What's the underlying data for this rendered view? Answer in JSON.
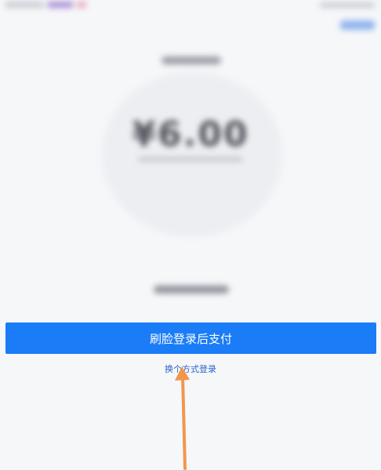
{
  "main": {
    "amount": "¥6.00"
  },
  "actions": {
    "pay_button_label": "刷脸登录后支付",
    "switch_method_label": "换个方式登录"
  },
  "colors": {
    "primary_button": "#1a7cf7",
    "link": "#2a62c9",
    "annotation_arrow": "#f2964c"
  }
}
